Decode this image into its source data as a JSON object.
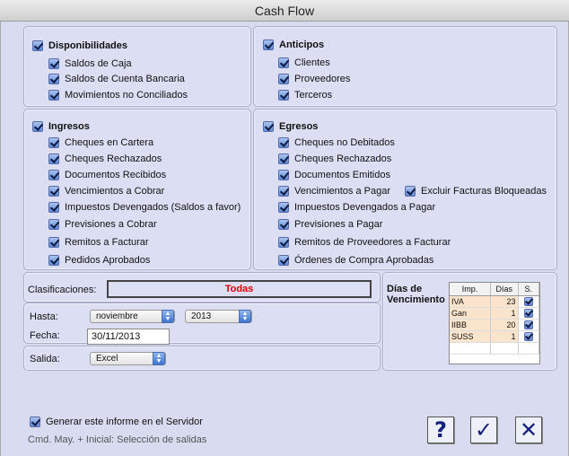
{
  "window": {
    "title": "Cash Flow"
  },
  "disponibilidades": {
    "header": "Disponibilidades",
    "items": [
      "Saldos de Caja",
      "Saldos de Cuenta Bancaria",
      "Movimientos no Conciliados"
    ]
  },
  "anticipos": {
    "header": "Anticipos",
    "items": [
      "Clientes",
      "Proveedores",
      "Terceros"
    ]
  },
  "ingresos": {
    "header": "Ingresos",
    "items": [
      "Cheques en Cartera",
      "Cheques Rechazados",
      "Documentos Recibidos",
      "Vencimientos a Cobrar",
      "Impuestos Devengados (Saldos a favor)",
      "Previsiones a Cobrar",
      "Remitos a Facturar",
      "Pedidos Aprobados"
    ]
  },
  "egresos": {
    "header": "Egresos",
    "items": [
      "Cheques no Debitados",
      "Cheques Rechazados",
      "Documentos Emitidos",
      "Vencimientos a Pagar",
      "Impuestos Devengados a Pagar",
      "Previsiones a Pagar",
      "Remitos de Proveedores a Facturar",
      "Órdenes de Compra Aprobadas"
    ],
    "excluir_label": "Excluir Facturas Bloqueadas"
  },
  "clasificaciones": {
    "label": "Clasificaciones:",
    "value": "Todas"
  },
  "hasta": {
    "label": "Hasta:",
    "month": "noviembre",
    "year": "2013"
  },
  "fecha": {
    "label": "Fecha:",
    "value": "30/11/2013"
  },
  "salida": {
    "label": "Salida:",
    "value": "Excel"
  },
  "vencimiento": {
    "label": "Días de Vencimiento",
    "headers": [
      "Imp.",
      "Días",
      "S."
    ],
    "rows": [
      {
        "imp": "IVA",
        "dias": "23"
      },
      {
        "imp": "Gan",
        "dias": "1"
      },
      {
        "imp": "IIBB",
        "dias": "20"
      },
      {
        "imp": "SUSS",
        "dias": "1"
      }
    ]
  },
  "footer": {
    "servidor_label": "Generar este informe en el Servidor",
    "hint": "Cmd. May. + Inicial: Selección de salidas"
  },
  "buttons": {
    "help": "?",
    "ok": "✓",
    "cancel": "✕"
  },
  "colors": {
    "background": "#d9dbf1",
    "todas": "#dd0000",
    "button_glyph": "#14207a"
  }
}
